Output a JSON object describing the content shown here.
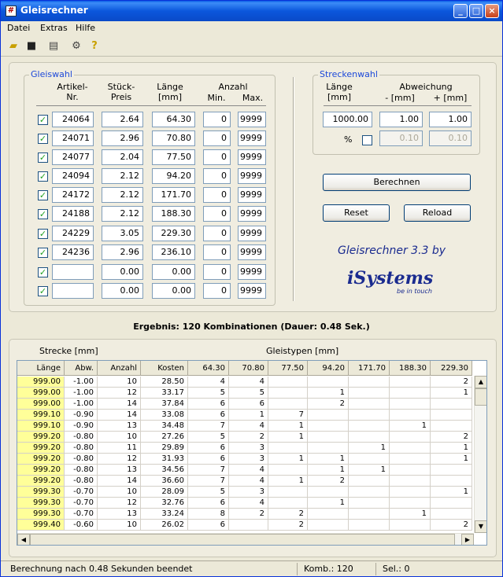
{
  "window": {
    "title": "Gleisrechner"
  },
  "menu": [
    "Datei",
    "Extras",
    "Hilfe"
  ],
  "toolbar_icons": [
    "open-folder-icon",
    "save-icon",
    "print-icon",
    "settings-icon",
    "help-icon"
  ],
  "gleiswahl": {
    "legend": "Gleiswahl",
    "headers": {
      "artikel": "Artikel-\nNr.",
      "preis": "Stück-\nPreis",
      "laenge": "Länge\n[mm]",
      "anzahl": "Anzahl",
      "min": "Min.",
      "max": "Max."
    },
    "rows": [
      {
        "checked": true,
        "artikel": "24064",
        "preis": "2.64",
        "laenge": "64.30",
        "min": "0",
        "max": "9999"
      },
      {
        "checked": true,
        "artikel": "24071",
        "preis": "2.96",
        "laenge": "70.80",
        "min": "0",
        "max": "9999"
      },
      {
        "checked": true,
        "artikel": "24077",
        "preis": "2.04",
        "laenge": "77.50",
        "min": "0",
        "max": "9999"
      },
      {
        "checked": true,
        "artikel": "24094",
        "preis": "2.12",
        "laenge": "94.20",
        "min": "0",
        "max": "9999"
      },
      {
        "checked": true,
        "artikel": "24172",
        "preis": "2.12",
        "laenge": "171.70",
        "min": "0",
        "max": "9999"
      },
      {
        "checked": true,
        "artikel": "24188",
        "preis": "2.12",
        "laenge": "188.30",
        "min": "0",
        "max": "9999"
      },
      {
        "checked": true,
        "artikel": "24229",
        "preis": "3.05",
        "laenge": "229.30",
        "min": "0",
        "max": "9999"
      },
      {
        "checked": true,
        "artikel": "24236",
        "preis": "2.96",
        "laenge": "236.10",
        "min": "0",
        "max": "9999"
      },
      {
        "checked": true,
        "artikel": "",
        "preis": "0.00",
        "laenge": "0.00",
        "min": "0",
        "max": "9999"
      },
      {
        "checked": true,
        "artikel": "",
        "preis": "0.00",
        "laenge": "0.00",
        "min": "0",
        "max": "9999"
      }
    ]
  },
  "streckenwahl": {
    "legend": "Streckenwahl",
    "headers": {
      "laenge": "Länge\n[mm]",
      "abweichung": "Abweichung",
      "minus": "- [mm]",
      "plus": "+ [mm]"
    },
    "laenge": "1000.00",
    "minus": "1.00",
    "plus": "1.00",
    "percent_label": "%",
    "percent_checked": false,
    "minus_pct": "0.10",
    "plus_pct": "0.10"
  },
  "buttons": {
    "berechnen": "Berechnen",
    "reset": "Reset",
    "reload": "Reload"
  },
  "logo": {
    "title": "Gleisrechner 3.3 by",
    "brand": "iSystems",
    "tagline": "be in touch"
  },
  "result": "Ergebnis: 120 Kombinationen (Dauer: 0.48 Sek.)",
  "table": {
    "group_strecke": "Strecke [mm]",
    "group_gleistypen": "Gleistypen [mm]",
    "columns": [
      "Länge",
      "Abw.",
      "Anzahl",
      "Kosten",
      "64.30",
      "70.80",
      "77.50",
      "94.20",
      "171.70",
      "188.30",
      "229.30"
    ],
    "rows": [
      [
        "999.00",
        "-1.00",
        "10",
        "28.50",
        "4",
        "4",
        "",
        "",
        "",
        "",
        "2"
      ],
      [
        "999.00",
        "-1.00",
        "12",
        "33.17",
        "5",
        "5",
        "",
        "1",
        "",
        "",
        "1"
      ],
      [
        "999.00",
        "-1.00",
        "14",
        "37.84",
        "6",
        "6",
        "",
        "2",
        "",
        "",
        ""
      ],
      [
        "999.10",
        "-0.90",
        "14",
        "33.08",
        "6",
        "1",
        "7",
        "",
        "",
        "",
        ""
      ],
      [
        "999.10",
        "-0.90",
        "13",
        "34.48",
        "7",
        "4",
        "1",
        "",
        "",
        "1",
        ""
      ],
      [
        "999.20",
        "-0.80",
        "10",
        "27.26",
        "5",
        "2",
        "1",
        "",
        "",
        "",
        "2"
      ],
      [
        "999.20",
        "-0.80",
        "11",
        "29.89",
        "6",
        "3",
        "",
        "",
        "1",
        "",
        "1"
      ],
      [
        "999.20",
        "-0.80",
        "12",
        "31.93",
        "6",
        "3",
        "1",
        "1",
        "",
        "",
        "1"
      ],
      [
        "999.20",
        "-0.80",
        "13",
        "34.56",
        "7",
        "4",
        "",
        "1",
        "1",
        "",
        ""
      ],
      [
        "999.20",
        "-0.80",
        "14",
        "36.60",
        "7",
        "4",
        "1",
        "2",
        "",
        "",
        ""
      ],
      [
        "999.30",
        "-0.70",
        "10",
        "28.09",
        "5",
        "3",
        "",
        "",
        "",
        "",
        "1"
      ],
      [
        "999.30",
        "-0.70",
        "12",
        "32.76",
        "6",
        "4",
        "",
        "1",
        "",
        "",
        ""
      ],
      [
        "999.30",
        "-0.70",
        "13",
        "33.24",
        "8",
        "2",
        "2",
        "",
        "",
        "1",
        ""
      ],
      [
        "999.40",
        "-0.60",
        "10",
        "26.02",
        "6",
        "",
        "2",
        "",
        "",
        "",
        "2"
      ]
    ]
  },
  "status": {
    "message": "Berechnung nach 0.48 Sekunden beendet",
    "komb": "Komb.: 120",
    "sel": "Sel.: 0"
  },
  "colors": {
    "title_bar": "#0a56d8",
    "legend_blue": "#1c48d9",
    "highlight_yellow": "#ffff99",
    "logo_blue": "#1a2b8f"
  }
}
